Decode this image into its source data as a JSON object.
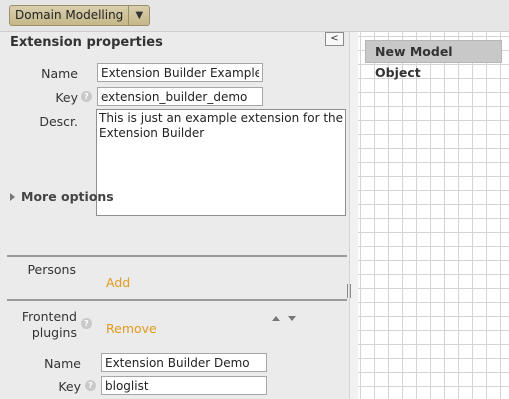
{
  "toolbar": {
    "module_label": "Domain Modelling"
  },
  "panel": {
    "title": "Extension properties",
    "name_label": "Name",
    "name_value": "Extension Builder Example",
    "key_label": "Key",
    "key_value": "extension_builder_demo",
    "descr_label": "Descr.",
    "descr_value": "This is just an example extension for the Extension Builder",
    "more_options": "More options",
    "persons_label": "Persons",
    "persons_add": "Add",
    "plugins_label_line1": "Frontend",
    "plugins_label_line2": "plugins",
    "plugins_remove": "Remove",
    "plugin_name_label": "Name",
    "plugin_name_value": "Extension Builder Demo",
    "plugin_key_label": "Key",
    "plugin_key_value": "bloglist"
  },
  "canvas": {
    "new_object_label": "New Model Object"
  }
}
